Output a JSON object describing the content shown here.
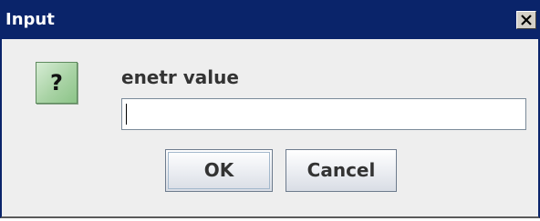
{
  "window": {
    "title": "Input"
  },
  "dialog": {
    "icon": "question-icon",
    "icon_glyph": "?",
    "prompt": "enetr value",
    "input_value": ""
  },
  "buttons": {
    "ok_label": "OK",
    "cancel_label": "Cancel"
  },
  "colors": {
    "titlebar": "#0a246a",
    "icon_fill": "#a9d3a5",
    "dialog_bg": "#eeeeee"
  }
}
